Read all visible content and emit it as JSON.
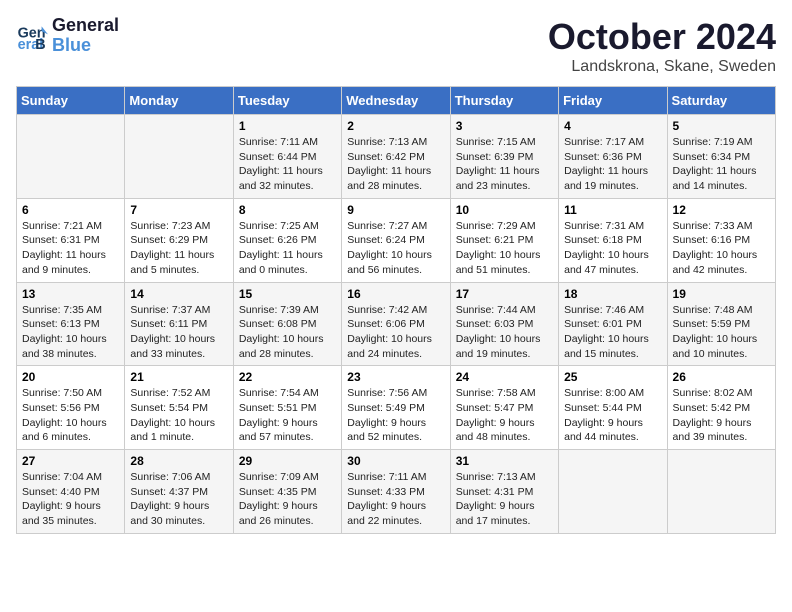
{
  "logo": {
    "line1": "General",
    "line2": "Blue"
  },
  "title": "October 2024",
  "location": "Landskrona, Skane, Sweden",
  "days_of_week": [
    "Sunday",
    "Monday",
    "Tuesday",
    "Wednesday",
    "Thursday",
    "Friday",
    "Saturday"
  ],
  "weeks": [
    [
      {
        "day": "",
        "info": ""
      },
      {
        "day": "",
        "info": ""
      },
      {
        "day": "1",
        "info": "Sunrise: 7:11 AM\nSunset: 6:44 PM\nDaylight: 11 hours\nand 32 minutes."
      },
      {
        "day": "2",
        "info": "Sunrise: 7:13 AM\nSunset: 6:42 PM\nDaylight: 11 hours\nand 28 minutes."
      },
      {
        "day": "3",
        "info": "Sunrise: 7:15 AM\nSunset: 6:39 PM\nDaylight: 11 hours\nand 23 minutes."
      },
      {
        "day": "4",
        "info": "Sunrise: 7:17 AM\nSunset: 6:36 PM\nDaylight: 11 hours\nand 19 minutes."
      },
      {
        "day": "5",
        "info": "Sunrise: 7:19 AM\nSunset: 6:34 PM\nDaylight: 11 hours\nand 14 minutes."
      }
    ],
    [
      {
        "day": "6",
        "info": "Sunrise: 7:21 AM\nSunset: 6:31 PM\nDaylight: 11 hours\nand 9 minutes."
      },
      {
        "day": "7",
        "info": "Sunrise: 7:23 AM\nSunset: 6:29 PM\nDaylight: 11 hours\nand 5 minutes."
      },
      {
        "day": "8",
        "info": "Sunrise: 7:25 AM\nSunset: 6:26 PM\nDaylight: 11 hours\nand 0 minutes."
      },
      {
        "day": "9",
        "info": "Sunrise: 7:27 AM\nSunset: 6:24 PM\nDaylight: 10 hours\nand 56 minutes."
      },
      {
        "day": "10",
        "info": "Sunrise: 7:29 AM\nSunset: 6:21 PM\nDaylight: 10 hours\nand 51 minutes."
      },
      {
        "day": "11",
        "info": "Sunrise: 7:31 AM\nSunset: 6:18 PM\nDaylight: 10 hours\nand 47 minutes."
      },
      {
        "day": "12",
        "info": "Sunrise: 7:33 AM\nSunset: 6:16 PM\nDaylight: 10 hours\nand 42 minutes."
      }
    ],
    [
      {
        "day": "13",
        "info": "Sunrise: 7:35 AM\nSunset: 6:13 PM\nDaylight: 10 hours\nand 38 minutes."
      },
      {
        "day": "14",
        "info": "Sunrise: 7:37 AM\nSunset: 6:11 PM\nDaylight: 10 hours\nand 33 minutes."
      },
      {
        "day": "15",
        "info": "Sunrise: 7:39 AM\nSunset: 6:08 PM\nDaylight: 10 hours\nand 28 minutes."
      },
      {
        "day": "16",
        "info": "Sunrise: 7:42 AM\nSunset: 6:06 PM\nDaylight: 10 hours\nand 24 minutes."
      },
      {
        "day": "17",
        "info": "Sunrise: 7:44 AM\nSunset: 6:03 PM\nDaylight: 10 hours\nand 19 minutes."
      },
      {
        "day": "18",
        "info": "Sunrise: 7:46 AM\nSunset: 6:01 PM\nDaylight: 10 hours\nand 15 minutes."
      },
      {
        "day": "19",
        "info": "Sunrise: 7:48 AM\nSunset: 5:59 PM\nDaylight: 10 hours\nand 10 minutes."
      }
    ],
    [
      {
        "day": "20",
        "info": "Sunrise: 7:50 AM\nSunset: 5:56 PM\nDaylight: 10 hours\nand 6 minutes."
      },
      {
        "day": "21",
        "info": "Sunrise: 7:52 AM\nSunset: 5:54 PM\nDaylight: 10 hours\nand 1 minute."
      },
      {
        "day": "22",
        "info": "Sunrise: 7:54 AM\nSunset: 5:51 PM\nDaylight: 9 hours\nand 57 minutes."
      },
      {
        "day": "23",
        "info": "Sunrise: 7:56 AM\nSunset: 5:49 PM\nDaylight: 9 hours\nand 52 minutes."
      },
      {
        "day": "24",
        "info": "Sunrise: 7:58 AM\nSunset: 5:47 PM\nDaylight: 9 hours\nand 48 minutes."
      },
      {
        "day": "25",
        "info": "Sunrise: 8:00 AM\nSunset: 5:44 PM\nDaylight: 9 hours\nand 44 minutes."
      },
      {
        "day": "26",
        "info": "Sunrise: 8:02 AM\nSunset: 5:42 PM\nDaylight: 9 hours\nand 39 minutes."
      }
    ],
    [
      {
        "day": "27",
        "info": "Sunrise: 7:04 AM\nSunset: 4:40 PM\nDaylight: 9 hours\nand 35 minutes."
      },
      {
        "day": "28",
        "info": "Sunrise: 7:06 AM\nSunset: 4:37 PM\nDaylight: 9 hours\nand 30 minutes."
      },
      {
        "day": "29",
        "info": "Sunrise: 7:09 AM\nSunset: 4:35 PM\nDaylight: 9 hours\nand 26 minutes."
      },
      {
        "day": "30",
        "info": "Sunrise: 7:11 AM\nSunset: 4:33 PM\nDaylight: 9 hours\nand 22 minutes."
      },
      {
        "day": "31",
        "info": "Sunrise: 7:13 AM\nSunset: 4:31 PM\nDaylight: 9 hours\nand 17 minutes."
      },
      {
        "day": "",
        "info": ""
      },
      {
        "day": "",
        "info": ""
      }
    ]
  ]
}
